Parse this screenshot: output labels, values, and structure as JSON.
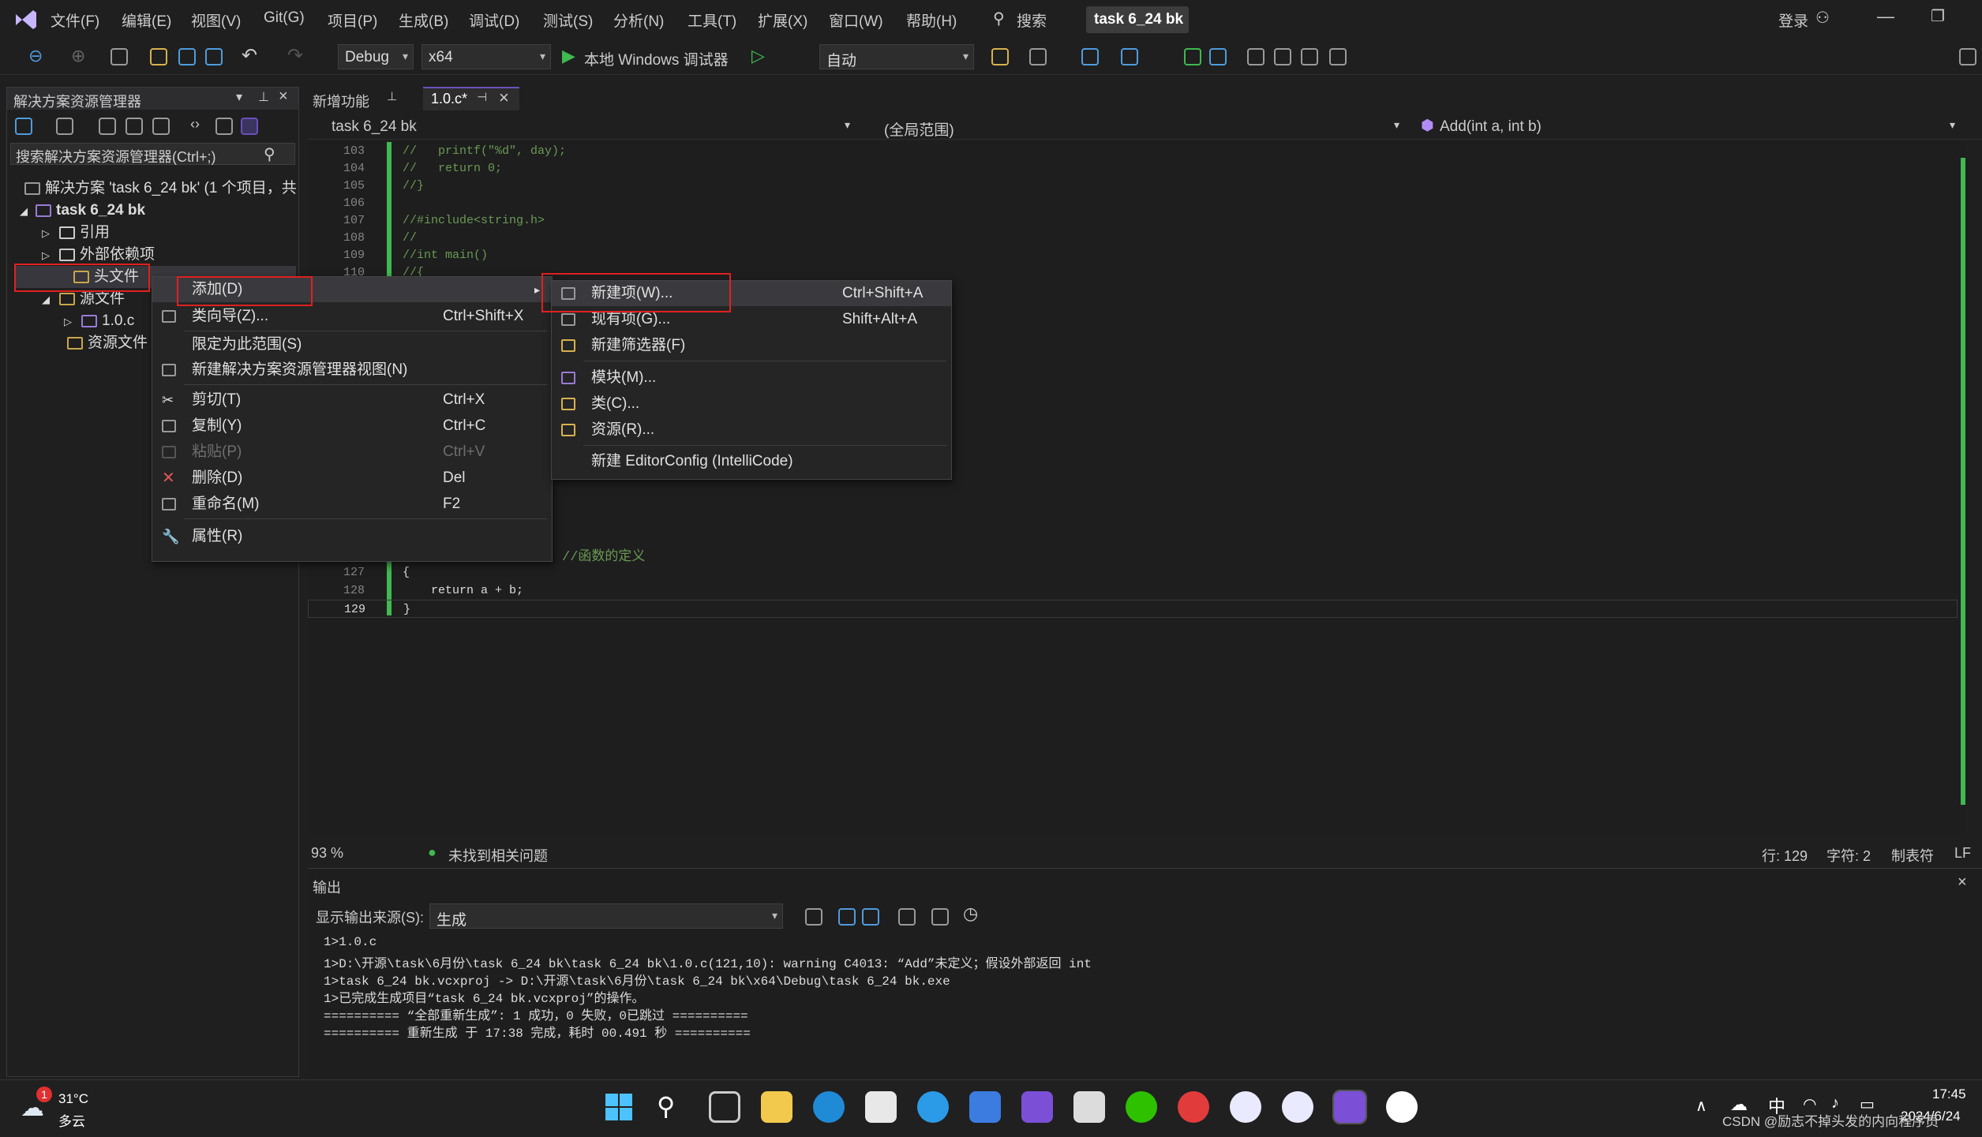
{
  "titlebar": {
    "menus": [
      "文件(F)",
      "编辑(E)",
      "视图(V)",
      "Git(G)",
      "项目(P)",
      "生成(B)",
      "调试(D)",
      "测试(S)",
      "分析(N)",
      "工具(T)",
      "扩展(X)",
      "窗口(W)",
      "帮助(H)"
    ],
    "search_label": "搜索",
    "solution_title": "task 6_24 bk",
    "login_label": "登录"
  },
  "toolbar": {
    "config": "Debug",
    "platform": "x64",
    "run_label": "本地 Windows 调试器",
    "auto": "自动"
  },
  "solution_explorer": {
    "title": "解决方案资源管理器",
    "search_placeholder": "搜索解决方案资源管理器(Ctrl+;)",
    "solution_row": "解决方案 'task 6_24 bk' (1 个项目，共",
    "project": "task 6_24 bk",
    "refs": "引用",
    "external": "外部依赖项",
    "headers": "头文件",
    "sources": "源文件",
    "file_c": "1.0.c",
    "resources": "资源文件"
  },
  "editor": {
    "tabs": [
      "新增功能",
      "1.0.c*"
    ],
    "nav_project": "task 6_24 bk",
    "nav_scope": "(全局范围)",
    "nav_func": "Add(int a, int b)",
    "lines": [
      {
        "n": "103",
        "t": "//   printf(\"%d\", day);"
      },
      {
        "n": "104",
        "t": "//   return 0;"
      },
      {
        "n": "105",
        "t": "//}"
      },
      {
        "n": "106",
        "t": ""
      },
      {
        "n": "107",
        "t": "//#include<string.h>"
      },
      {
        "n": "108",
        "t": "//"
      },
      {
        "n": "109",
        "t": "//int main()"
      },
      {
        "n": "110",
        "t": "//{"
      }
    ],
    "lines_bottom": [
      {
        "n": "127",
        "t": "{"
      },
      {
        "n": "128",
        "t": "    return a + b;"
      },
      {
        "n": "129",
        "t": "}"
      }
    ],
    "comment_def": "//函数的定义",
    "status": {
      "zoom": "93 %",
      "issues": "未找到相关问题",
      "line": "行: 129",
      "char": "字符: 2",
      "tab": "制表符",
      "eol": "LF"
    }
  },
  "context_menu": {
    "items": [
      {
        "label": "添加(D)",
        "shortcut": "",
        "arrow": true
      },
      {
        "label": "类向导(Z)...",
        "shortcut": "Ctrl+Shift+X"
      },
      {
        "label": "限定为此范围(S)",
        "shortcut": ""
      },
      {
        "label": "新建解决方案资源管理器视图(N)",
        "shortcut": ""
      },
      {
        "label": "剪切(T)",
        "shortcut": "Ctrl+X"
      },
      {
        "label": "复制(Y)",
        "shortcut": "Ctrl+C"
      },
      {
        "label": "粘贴(P)",
        "shortcut": "Ctrl+V",
        "disabled": true
      },
      {
        "label": "删除(D)",
        "shortcut": "Del"
      },
      {
        "label": "重命名(M)",
        "shortcut": "F2"
      },
      {
        "label": "属性(R)",
        "shortcut": ""
      }
    ]
  },
  "submenu": {
    "items": [
      {
        "label": "新建项(W)...",
        "shortcut": "Ctrl+Shift+A"
      },
      {
        "label": "现有项(G)...",
        "shortcut": "Shift+Alt+A"
      },
      {
        "label": "新建筛选器(F)",
        "shortcut": ""
      },
      {
        "label": "模块(M)...",
        "shortcut": ""
      },
      {
        "label": "类(C)...",
        "shortcut": ""
      },
      {
        "label": "资源(R)...",
        "shortcut": ""
      },
      {
        "label": "新建 EditorConfig (IntelliCode)",
        "shortcut": ""
      }
    ]
  },
  "output": {
    "title": "输出",
    "source_label": "显示输出来源(S):",
    "source_value": "生成",
    "lines": [
      "1>1.0.c",
      "1>D:\\开源\\task\\6月份\\task 6_24 bk\\task 6_24 bk\\1.0.c(121,10): warning C4013: “Add”未定义；假设外部返回 int",
      "1>task 6_24 bk.vcxproj -> D:\\开源\\task\\6月份\\task 6_24 bk\\x64\\Debug\\task 6_24 bk.exe",
      "1>已完成生成项目“task 6_24 bk.vcxproj”的操作。",
      "========== “全部重新生成”: 1 成功，0 失败，0已跳过 ==========",
      "========== 重新生成 于 17:38 完成，耗时 00.491 秒 =========="
    ]
  },
  "taskbar": {
    "weather_temp": "31°C",
    "weather_desc": "多云",
    "badge": "1",
    "ime": "中",
    "time": "17:45",
    "date": "2024/6/24",
    "watermark": "CSDN @励志不掉头发的内向程序员"
  },
  "colors": {
    "accent": "#6c4fbb",
    "highlight_box": "#e02020",
    "green_bar": "#3fb950"
  }
}
